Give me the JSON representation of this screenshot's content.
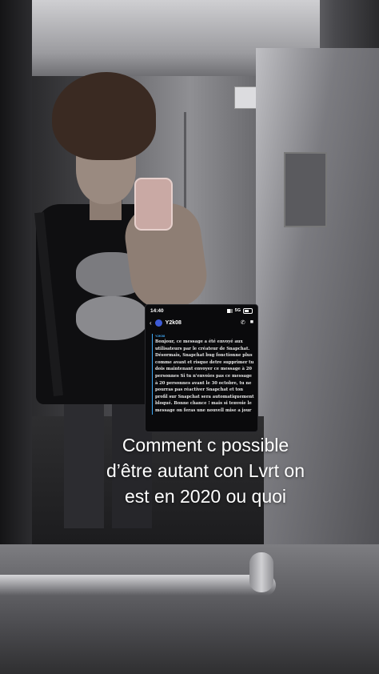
{
  "screenshot": {
    "status_time": "14:40",
    "network": "5G",
    "contact_name": "Y2k08",
    "sender_label": "Y2K08",
    "message": "Bonjour, ce message a été envoyé aux utilisateurs par le créateur de Snapchat. Désormais, Snapchat bug fonctionne plus comme avant et risque detre supprimer tu dois maintenant envoyer ce message à 20 personnes Si tu n'envoies pas ce message à 20 personnes avant le 30 octobre, tu ne pourras pas réactiver Snapchat et ton profil sur Snapchat sera automatiquement bloqué. Bonne chance ! mais si tenvoie le message on feras une nouvell mise a jour"
  },
  "caption": {
    "line1": "Comment c possible",
    "line2": "d’être autant con Lvrt on",
    "line3": "est en 2020 ou quoi"
  },
  "icons": [
    "back-chevron-icon",
    "avatar-icon",
    "phone-icon",
    "video-icon",
    "signal-icon",
    "battery-icon"
  ]
}
